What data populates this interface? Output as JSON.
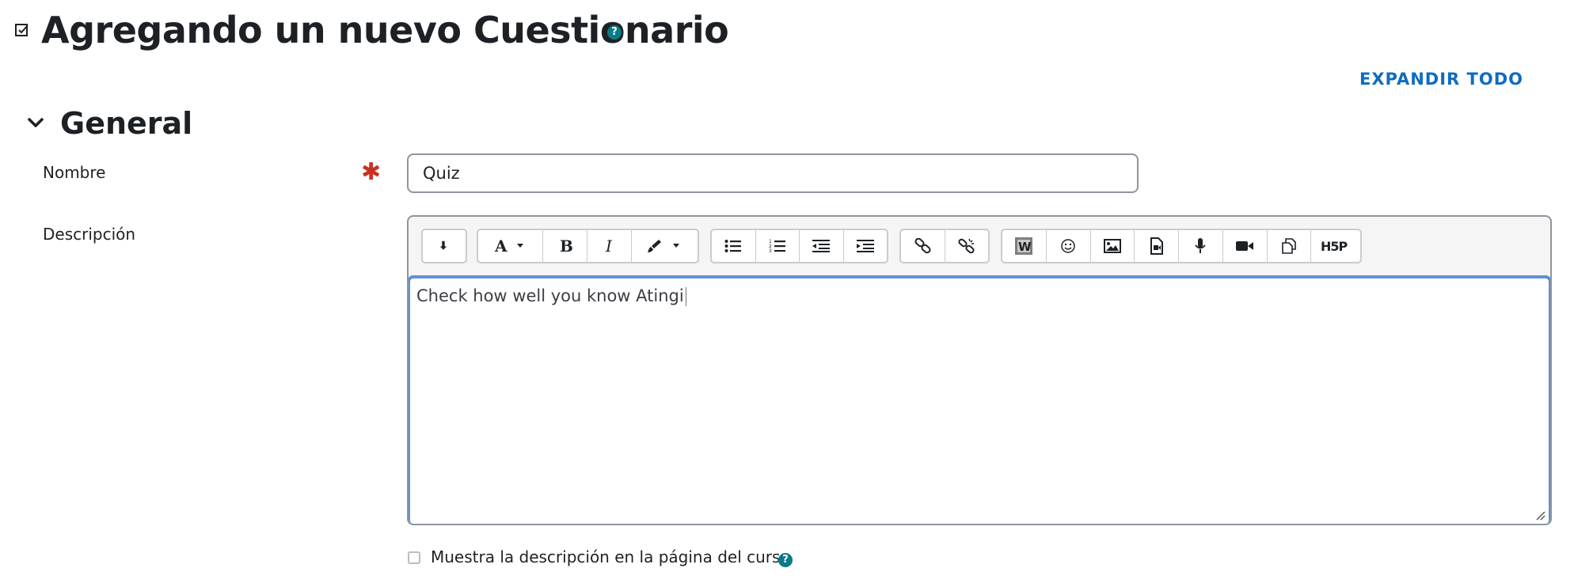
{
  "page": {
    "title": "Agregando un nuevo Cuestionario",
    "title_help": "?",
    "expand_all": "EXPANDIR TODO"
  },
  "section": {
    "title": "General",
    "chevron_icon": "chevron-down-icon"
  },
  "form": {
    "name_label": "Nombre",
    "name_required": "✱",
    "name_value": "Quiz",
    "description_label": "Descripción",
    "description_text": "Check how well you know Atingi",
    "show_description_label": "Muestra la descripción en la página del curso",
    "show_description_checked": false,
    "help": "?"
  },
  "toolbar": {
    "groups": [
      [
        "show-more-icon"
      ],
      [
        "font-style-icon",
        "bold-icon",
        "italic-icon",
        "paintbrush-icon"
      ],
      [
        "unordered-list-icon",
        "ordered-list-icon",
        "outdent-icon",
        "indent-icon"
      ],
      [
        "link-icon",
        "unlink-icon"
      ],
      [
        "word-import-icon",
        "emoji-icon",
        "image-icon",
        "media-icon",
        "record-audio-icon",
        "record-video-icon",
        "manage-files-icon",
        "h5p-icon"
      ]
    ],
    "h5p_label": "H5P"
  },
  "colors": {
    "accent": "#0f6cbf",
    "required": "#ca3120",
    "help": "#0b7a88",
    "focus_border": "#5b93d6"
  }
}
